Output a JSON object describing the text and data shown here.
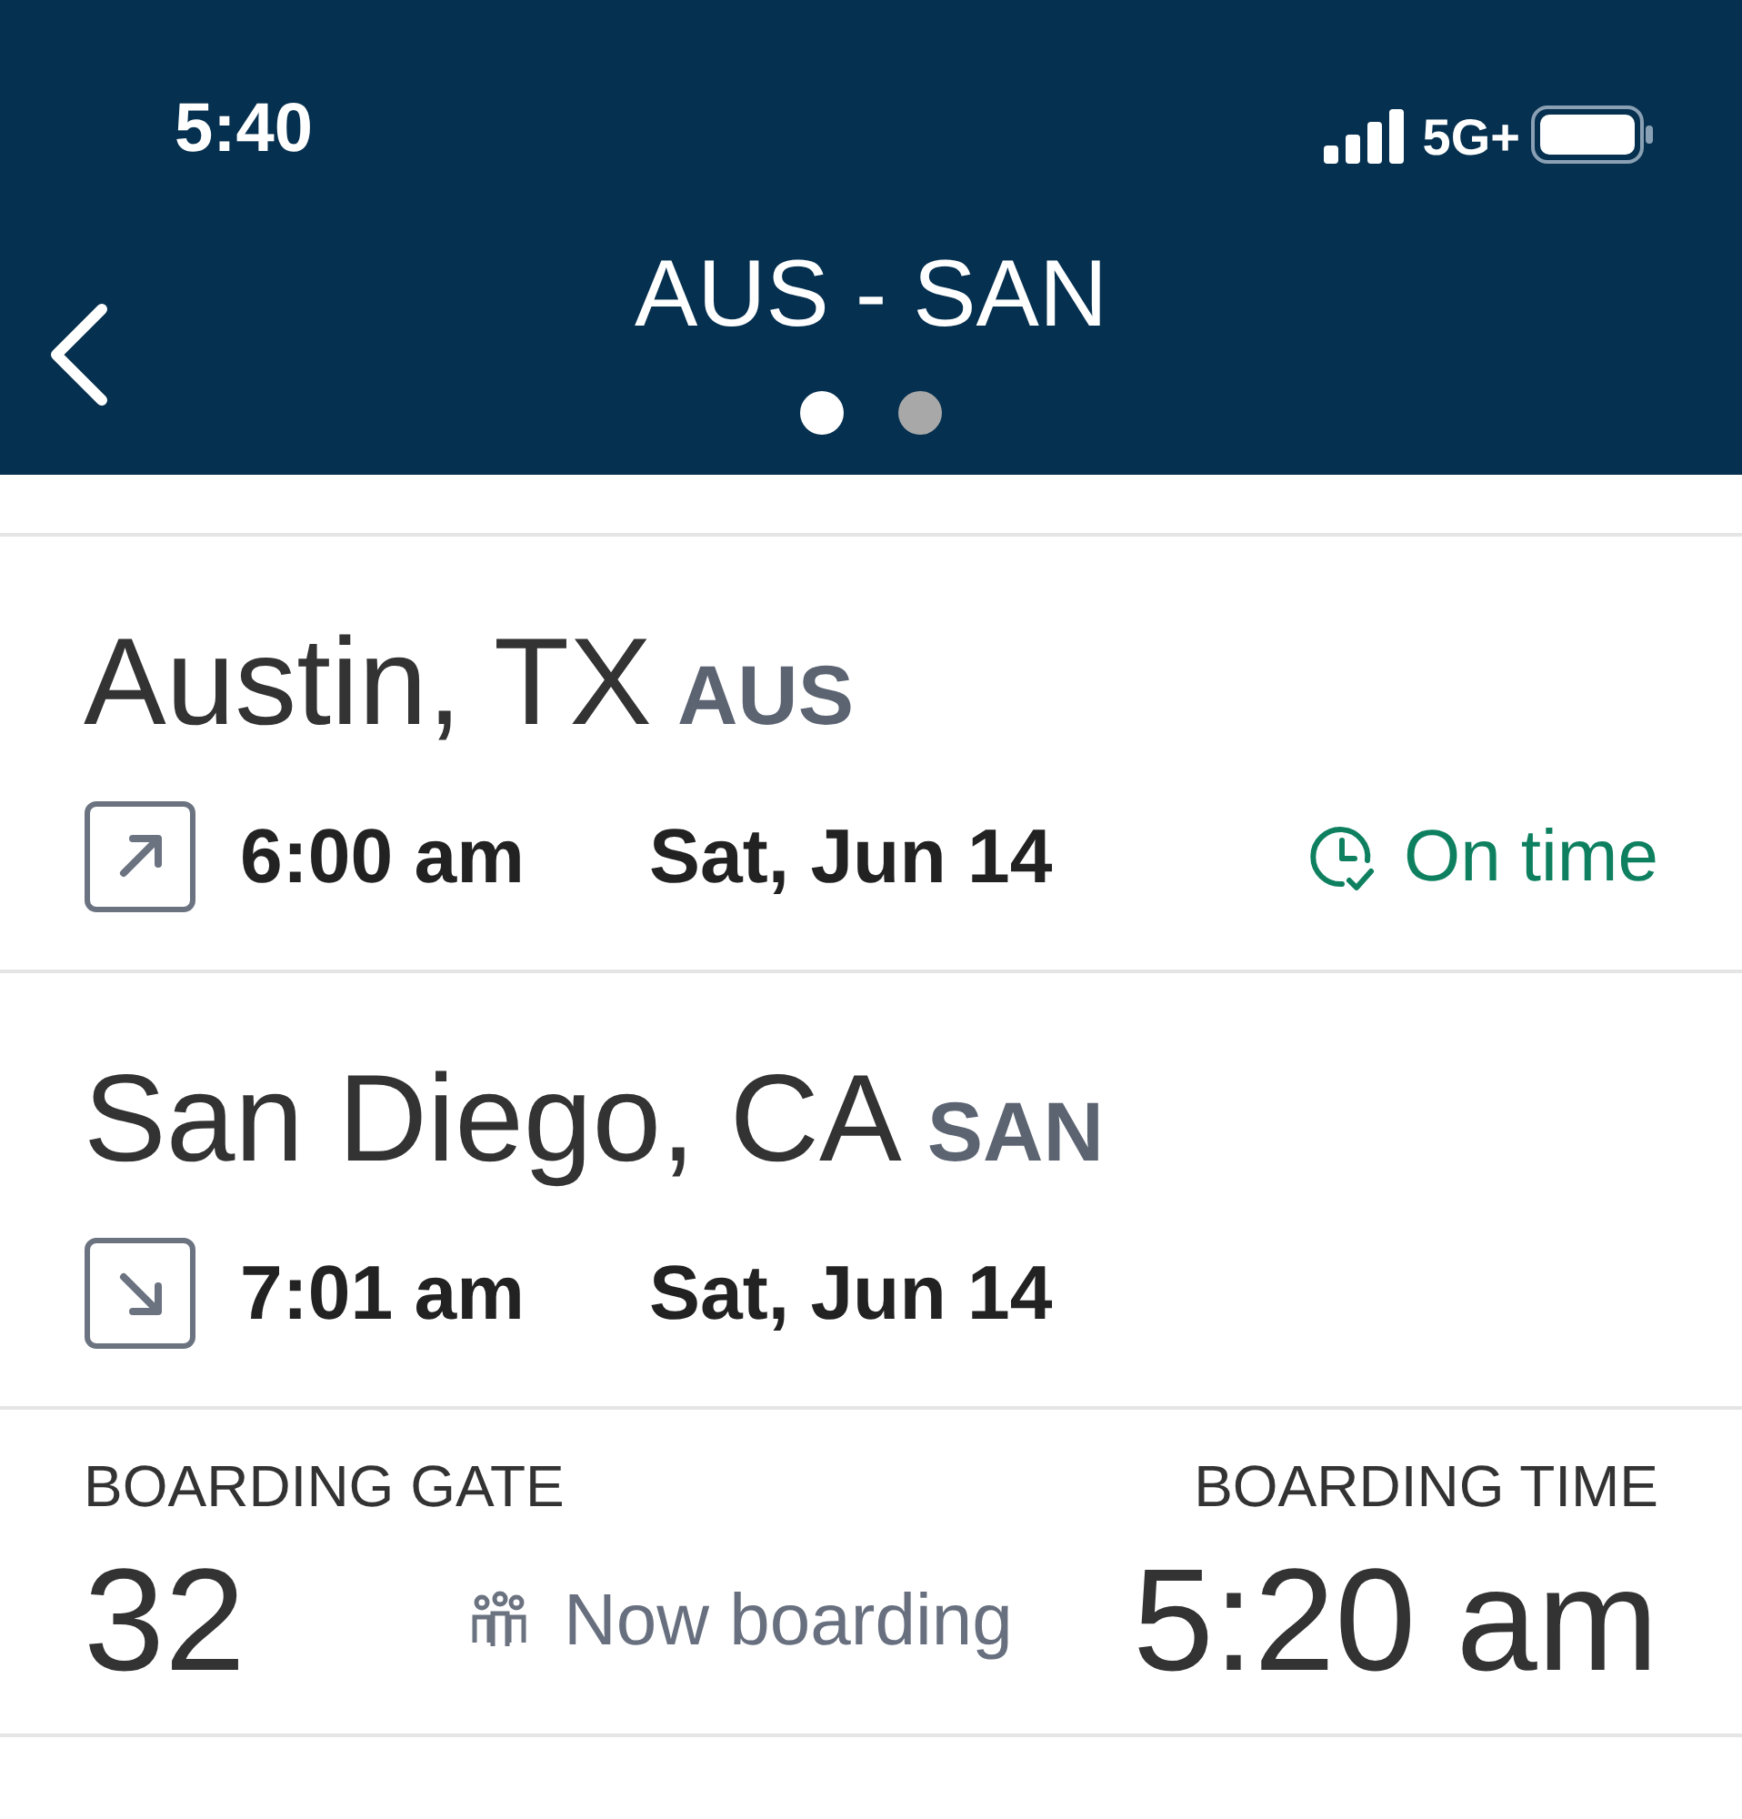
{
  "status_bar": {
    "time": "5:40",
    "network": "5G+"
  },
  "header": {
    "title": "AUS - SAN",
    "pages": [
      {
        "selected": true
      },
      {
        "selected": false
      }
    ]
  },
  "segments": [
    {
      "kind": "departure",
      "city": "Austin, TX",
      "code": "AUS",
      "time": "6:00 am",
      "date": "Sat, Jun 14",
      "status": {
        "text": "On time",
        "color": "#0e8060"
      }
    },
    {
      "kind": "arrival",
      "city": "San Diego, CA",
      "code": "SAN",
      "time": "7:01 am",
      "date": "Sat, Jun 14"
    }
  ],
  "boarding": {
    "gate_label": "BOARDING GATE",
    "gate": "32",
    "status": "Now boarding",
    "time_label": "BOARDING TIME",
    "time": "5:20 am"
  }
}
